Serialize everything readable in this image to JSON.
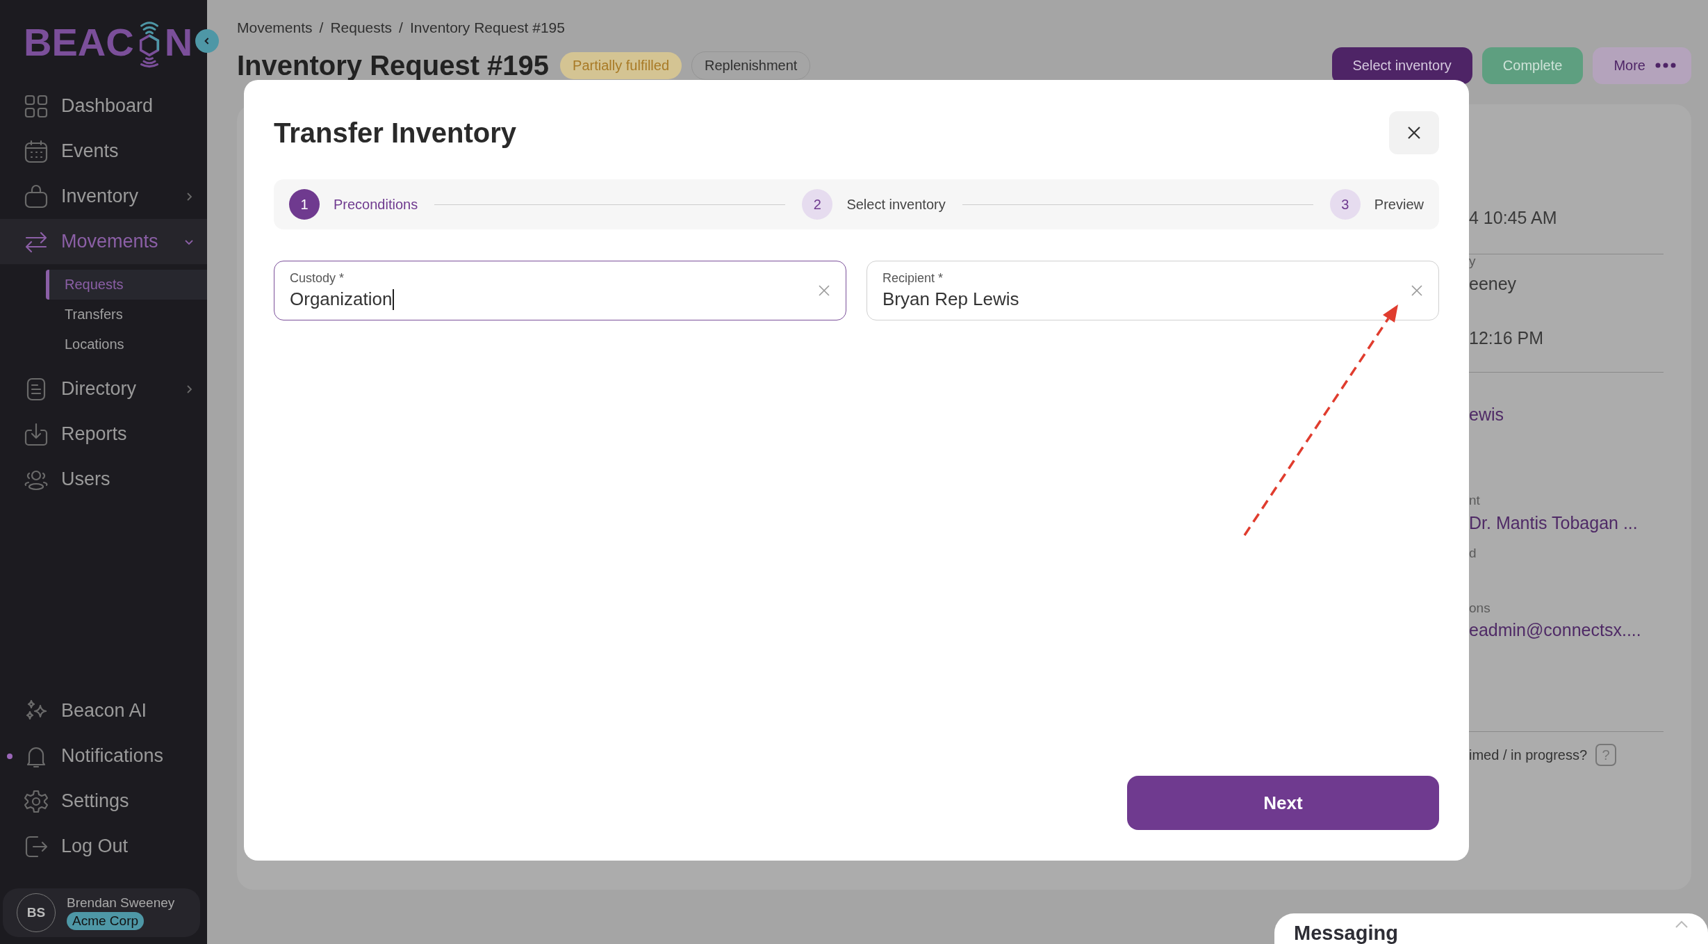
{
  "sidebar": {
    "logo": {
      "left": "BEAC",
      "right": "N"
    },
    "items": [
      {
        "label": "Dashboard",
        "selected": false,
        "expandable": false
      },
      {
        "label": "Events",
        "selected": false,
        "expandable": false
      },
      {
        "label": "Inventory",
        "selected": false,
        "expandable": true,
        "expanded": false
      },
      {
        "label": "Movements",
        "selected": true,
        "expandable": true,
        "expanded": true,
        "children": [
          {
            "label": "Requests",
            "selected": true
          },
          {
            "label": "Transfers",
            "selected": false
          },
          {
            "label": "Locations",
            "selected": false
          }
        ]
      },
      {
        "label": "Directory",
        "selected": false,
        "expandable": true,
        "expanded": false
      },
      {
        "label": "Reports",
        "selected": false,
        "expandable": false
      },
      {
        "label": "Users",
        "selected": false,
        "expandable": false
      }
    ],
    "bottom_items": [
      {
        "label": "Beacon AI",
        "unread": false
      },
      {
        "label": "Notifications",
        "unread": true
      },
      {
        "label": "Settings",
        "unread": false
      },
      {
        "label": "Log Out",
        "unread": false
      }
    ],
    "user": {
      "initials": "BS",
      "name": "Brendan Sweeney",
      "organization": "Acme Corp"
    }
  },
  "page": {
    "breadcrumb": [
      "Movements",
      "Requests",
      "Inventory Request #195"
    ],
    "separator": "/",
    "title": "Inventory Request #195",
    "badges": [
      {
        "label": "Partially fulfilled",
        "kind": "status"
      },
      {
        "label": "Replenishment",
        "kind": "tag"
      }
    ],
    "actions": [
      {
        "label": "Select inventory",
        "kind": "primary"
      },
      {
        "label": "Complete",
        "kind": "success"
      },
      {
        "label": "More",
        "kind": "more"
      }
    ],
    "details": [
      [
        {
          "text": "4 10:45 AM",
          "kind": "value"
        }
      ],
      [
        {
          "text": "y",
          "kind": "label"
        },
        {
          "text": "eeney",
          "kind": "value"
        },
        {
          "text": "12:16 PM",
          "kind": "value"
        }
      ],
      [
        {
          "text": "ewis",
          "kind": "link"
        },
        {
          "text": "nt",
          "kind": "label"
        },
        {
          "text": "Dr. Mantis Tobagan ...",
          "kind": "link"
        },
        {
          "text": "d",
          "kind": "label"
        },
        {
          "text": "ons",
          "kind": "label"
        },
        {
          "text": "eadmin@connectsx....",
          "kind": "link"
        }
      ],
      [
        {
          "text": "imed / in progress?",
          "kind": "question",
          "help": "?"
        }
      ]
    ]
  },
  "modal": {
    "title": "Transfer Inventory",
    "steps": [
      {
        "number": "1",
        "label": "Preconditions",
        "selected": true
      },
      {
        "number": "2",
        "label": "Select inventory",
        "selected": false
      },
      {
        "number": "3",
        "label": "Preview",
        "selected": false
      }
    ],
    "fields": [
      {
        "label": "Custody *",
        "value": "Organization",
        "focused": true
      },
      {
        "label": "Recipient *",
        "value": "Bryan Rep Lewis",
        "focused": false
      }
    ],
    "next_button": "Next"
  },
  "messaging": {
    "title": "Messaging",
    "expanded": false
  }
}
